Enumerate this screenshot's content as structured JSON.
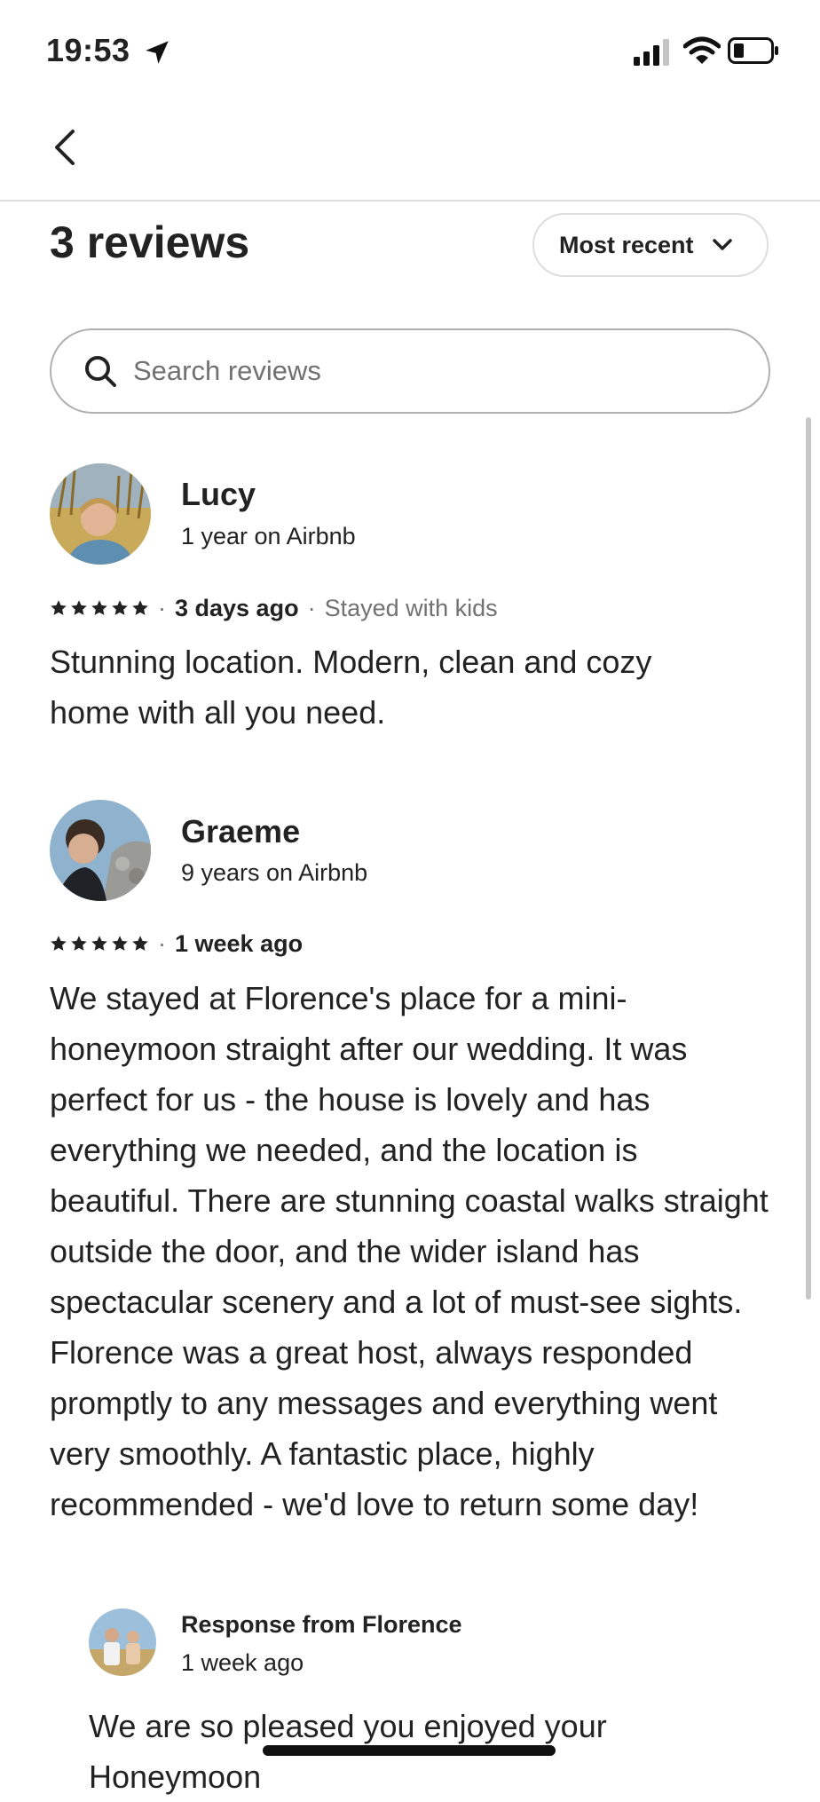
{
  "status_bar": {
    "time": "19:53",
    "icons": [
      "location-arrow-icon",
      "signal-icon",
      "wifi-icon",
      "battery-icon"
    ]
  },
  "header": {
    "back_icon": "chevron-left-icon",
    "title": "3 reviews",
    "sort_label": "Most recent"
  },
  "search": {
    "placeholder": "Search reviews"
  },
  "reviews": [
    {
      "name": "Lucy",
      "tenure": "1 year on Airbnb",
      "rating": 5,
      "when": "3 days ago",
      "trip_type": "Stayed with kids",
      "text": "Stunning location. Modern, clean and cozy home with all you need."
    },
    {
      "name": "Graeme",
      "tenure": "9 years on Airbnb",
      "rating": 5,
      "when": "1 week ago",
      "text": "We stayed at Florence's place for a mini-honeymoon straight after our wedding. It was perfect for us - the house is lovely and has everything we needed, and the location is beautiful. There are stunning coastal walks straight outside the door, and the wider island has spectacular scenery and a lot of must-see sights. Florence was a great host, always responded promptly to any messages and everything went very smoothly. A fantastic place, highly recommended - we'd love to return some day!",
      "response": {
        "title": "Response from Florence",
        "when": "1 week ago",
        "text": "We are so pleased you enjoyed your Honeymoon"
      }
    }
  ],
  "colors": {
    "text": "#222222",
    "secondary": "#717171",
    "border": "#dddddd"
  }
}
